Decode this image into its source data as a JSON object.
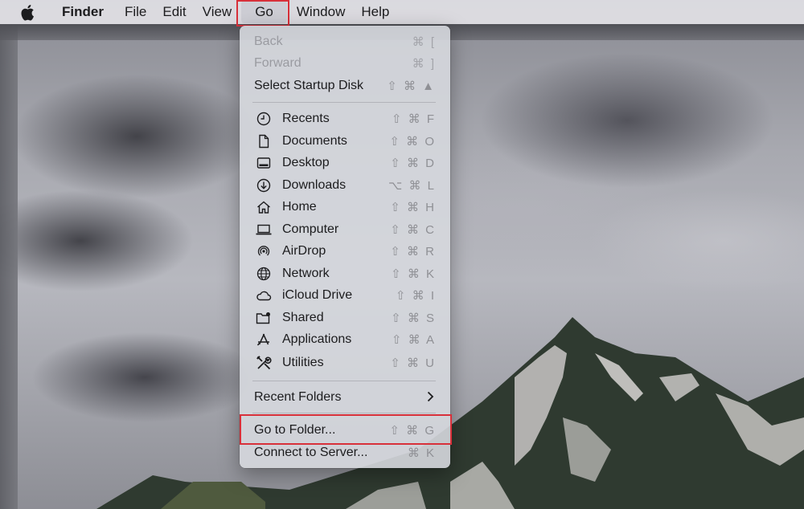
{
  "menubar": {
    "app_name": "Finder",
    "items": [
      "File",
      "Edit",
      "View",
      "Go",
      "Window",
      "Help"
    ]
  },
  "go_menu": {
    "back": {
      "label": "Back",
      "shortcut": "⌘ ["
    },
    "forward": {
      "label": "Forward",
      "shortcut": "⌘ ]"
    },
    "startup_disk": {
      "label": "Select Startup Disk",
      "shortcut": "⇧ ⌘ ▲"
    },
    "locations": [
      {
        "label": "Recents",
        "shortcut": "⇧ ⌘ F",
        "icon": "clock-icon"
      },
      {
        "label": "Documents",
        "shortcut": "⇧ ⌘ O",
        "icon": "document-icon"
      },
      {
        "label": "Desktop",
        "shortcut": "⇧ ⌘ D",
        "icon": "desktop-icon"
      },
      {
        "label": "Downloads",
        "shortcut": "⌥ ⌘ L",
        "icon": "download-icon"
      },
      {
        "label": "Home",
        "shortcut": "⇧ ⌘ H",
        "icon": "home-icon"
      },
      {
        "label": "Computer",
        "shortcut": "⇧ ⌘ C",
        "icon": "laptop-icon"
      },
      {
        "label": "AirDrop",
        "shortcut": "⇧ ⌘ R",
        "icon": "airdrop-icon"
      },
      {
        "label": "Network",
        "shortcut": "⇧ ⌘ K",
        "icon": "globe-icon"
      },
      {
        "label": "iCloud Drive",
        "shortcut": "⇧ ⌘ I",
        "icon": "cloud-icon"
      },
      {
        "label": "Shared",
        "shortcut": "⇧ ⌘ S",
        "icon": "shared-folder-icon"
      },
      {
        "label": "Applications",
        "shortcut": "⇧ ⌘ A",
        "icon": "applications-icon"
      },
      {
        "label": "Utilities",
        "shortcut": "⇧ ⌘ U",
        "icon": "utilities-icon"
      }
    ],
    "recent_folders": {
      "label": "Recent Folders"
    },
    "go_to_folder": {
      "label": "Go to Folder...",
      "shortcut": "⇧ ⌘ G"
    },
    "connect_to_server": {
      "label": "Connect to Server...",
      "shortcut": "⌘ K"
    }
  },
  "colors": {
    "highlight_border": "#d8303a",
    "disabled_text": "#9a9ba1",
    "shortcut_text": "#8f9095"
  }
}
